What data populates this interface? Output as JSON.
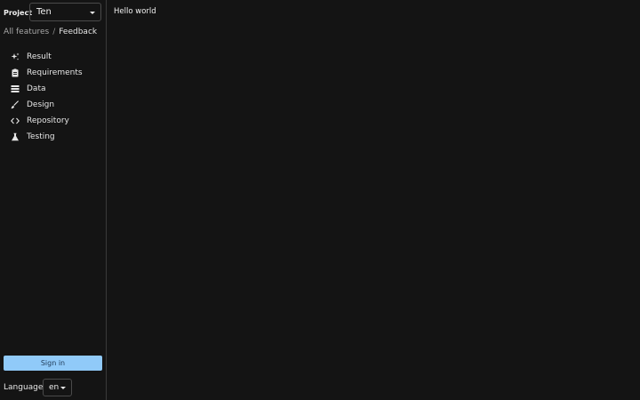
{
  "project": {
    "label": "Project",
    "selected": "Ten"
  },
  "breadcrumb": {
    "parent": "All features",
    "separator": "/",
    "current": "Feedback"
  },
  "nav": {
    "items": [
      {
        "label": "Result",
        "icon": "sparkle-icon"
      },
      {
        "label": "Requirements",
        "icon": "clipboard-icon"
      },
      {
        "label": "Data",
        "icon": "list-icon"
      },
      {
        "label": "Design",
        "icon": "brush-icon"
      },
      {
        "label": "Repository",
        "icon": "code-icon"
      },
      {
        "label": "Testing",
        "icon": "flask-icon"
      }
    ]
  },
  "sign_in": {
    "label": "Sign in",
    "color": "#90caf9"
  },
  "language": {
    "label": "Language",
    "selected": "en"
  },
  "main": {
    "content": "Hello world"
  }
}
